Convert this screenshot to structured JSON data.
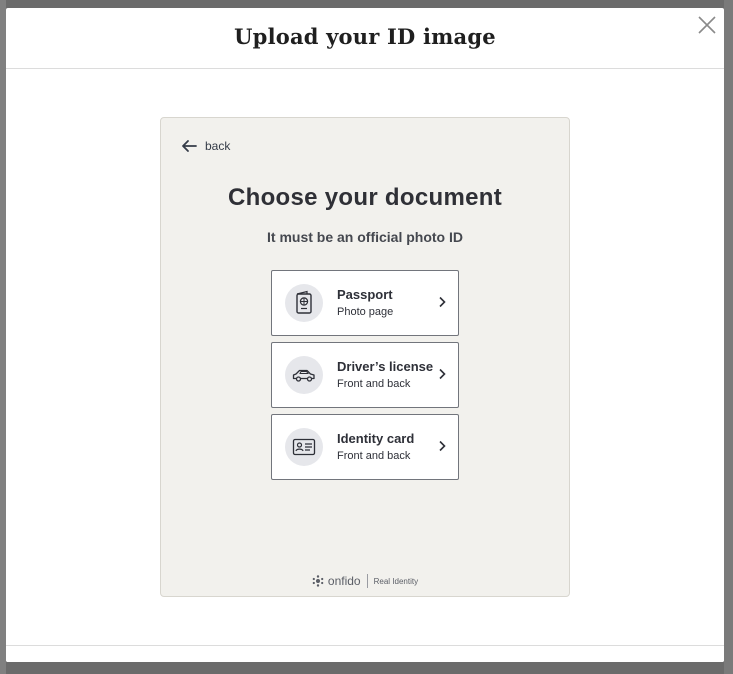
{
  "modal": {
    "title": "Upload your ID image"
  },
  "sdk": {
    "back_label": "back",
    "title": "Choose your document",
    "subtitle": "It must be an official photo ID",
    "documents": [
      {
        "label": "Passport",
        "hint": "Photo page",
        "icon": "passport-icon"
      },
      {
        "label": "Driver’s license",
        "hint": "Front and back",
        "icon": "car-icon"
      },
      {
        "label": "Identity card",
        "hint": "Front and back",
        "icon": "id-card-icon"
      }
    ],
    "footer": {
      "brand": "onfido",
      "tagline": "Real Identity"
    }
  },
  "colors": {
    "overlay": "#6b6b6b",
    "panel_bg": "#f2f1ed",
    "text_dark": "#2f3036",
    "icon_circle": "#e6e7eb"
  }
}
